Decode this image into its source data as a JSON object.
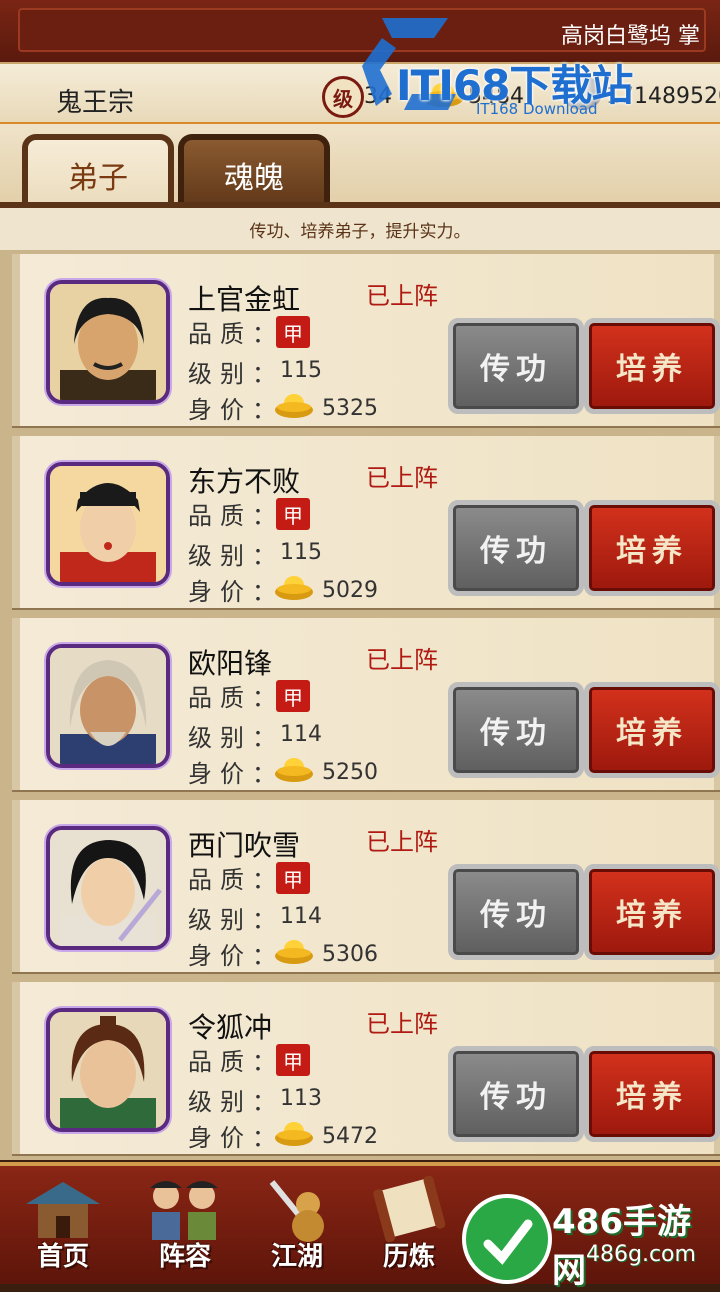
{
  "top_banner": {
    "marquee": "高岗白鹭坞 掌"
  },
  "status": {
    "sect": "鬼王宗",
    "level_label": "级",
    "level_value": "34",
    "gold": "5484",
    "silver": "171489520"
  },
  "watermark": {
    "text": "ITI68下载站",
    "sub": "IT168 Download"
  },
  "tabs": [
    {
      "label": "弟子",
      "active": true
    },
    {
      "label": "魂魄",
      "active": false
    }
  ],
  "hint": "传功、培养弟子，提升实力。",
  "labels": {
    "quality": "品质：",
    "level": "级别：",
    "price": "身价：",
    "quality_badge": "甲",
    "deployed": "已上阵",
    "transfer": "传功",
    "train": "培养"
  },
  "disciples": [
    {
      "name": "上官金虹",
      "level": "115",
      "price": "5325",
      "skin": "#d7a46e",
      "hair": "#1a1a1a",
      "robe": "#3a2a18"
    },
    {
      "name": "东方不败",
      "level": "115",
      "price": "5029",
      "skin": "#f0cfa8",
      "hair": "#1a1a1a",
      "robe": "#c0281c"
    },
    {
      "name": "欧阳锋",
      "level": "114",
      "price": "5250",
      "skin": "#c89366",
      "hair": "#cfc6b4",
      "robe": "#2c3f70"
    },
    {
      "name": "西门吹雪",
      "level": "114",
      "price": "5306",
      "skin": "#f0cfa8",
      "hair": "#151515",
      "robe": "#e8e2d6"
    },
    {
      "name": "令狐冲",
      "level": "113",
      "price": "5472",
      "skin": "#e9c29a",
      "hair": "#5a2a14",
      "robe": "#2f6a3a"
    }
  ],
  "nav": [
    {
      "label": "首页"
    },
    {
      "label": "阵容"
    },
    {
      "label": "江湖"
    },
    {
      "label": "历炼"
    }
  ],
  "badge": {
    "title": "486手游网",
    "url": "486g.com"
  }
}
